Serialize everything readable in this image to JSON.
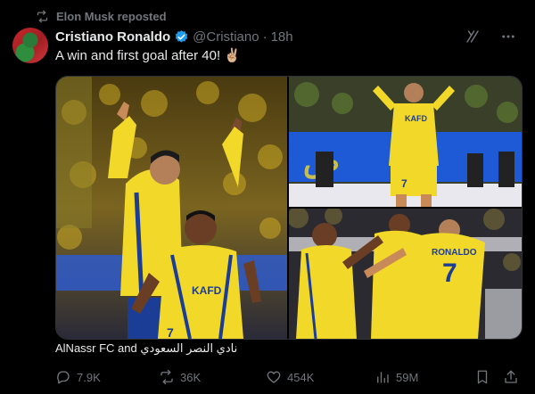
{
  "repost": {
    "text": "Elon Musk reposted"
  },
  "author": {
    "name": "Cristiano Ronaldo",
    "handle": "@Cristiano",
    "separator": "·",
    "time": "18h"
  },
  "tweet": {
    "text": "A win and first goal after 40! ✌🏼"
  },
  "media": {
    "caption": "AlNassr FC and نادي النصر السعودي"
  },
  "actions": {
    "replies": "7.9K",
    "reposts": "36K",
    "likes": "454K",
    "views": "59M"
  },
  "colors": {
    "verified": "#1d9bf0",
    "muted": "#71767b",
    "kit_yellow": "#f2d829",
    "kit_blue": "#1b3d96"
  },
  "images": [
    {
      "shirt_text": "KAFD",
      "number": "7"
    },
    {
      "shirt_text": "KAFD",
      "number": "7"
    },
    {
      "shirt_text": "RONALDO",
      "number": "7"
    }
  ]
}
